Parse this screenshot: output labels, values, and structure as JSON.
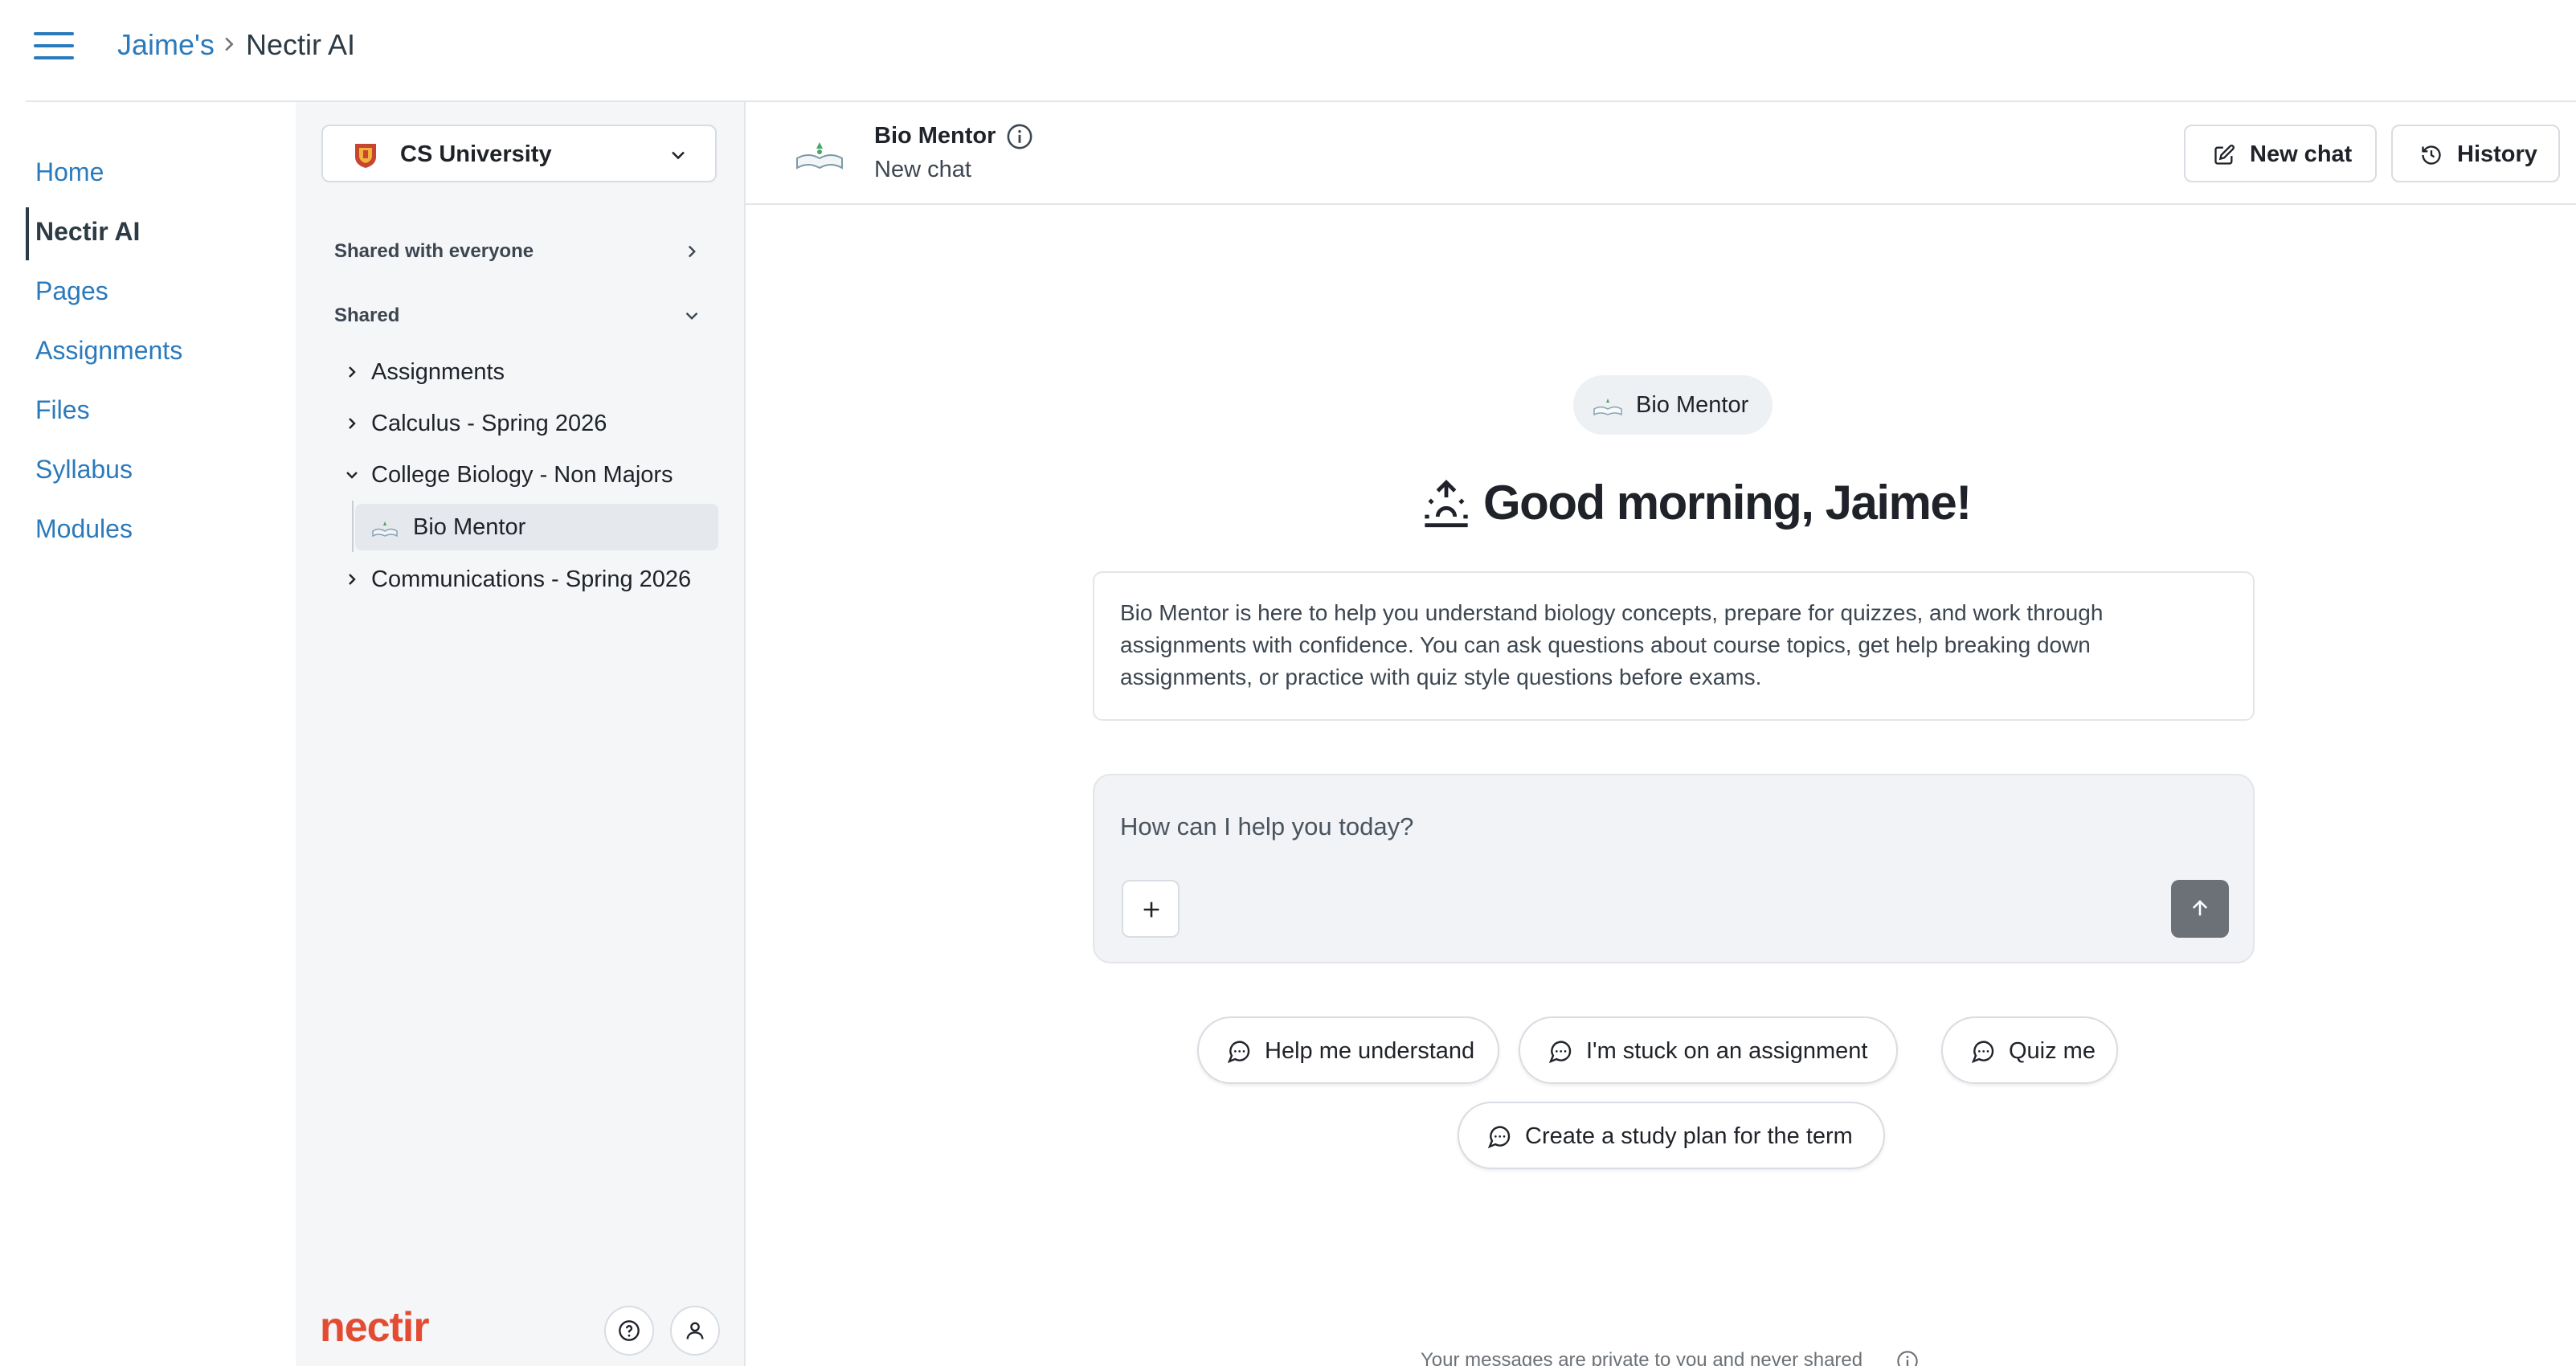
{
  "breadcrumb": {
    "parent": "Jaime's",
    "current": "Nectir AI"
  },
  "course_nav": {
    "items": [
      {
        "label": "Home"
      },
      {
        "label": "Nectir AI",
        "active": true
      },
      {
        "label": "Pages"
      },
      {
        "label": "Assignments"
      },
      {
        "label": "Files"
      },
      {
        "label": "Syllabus"
      },
      {
        "label": "Modules"
      }
    ]
  },
  "sidebar": {
    "org_selector": {
      "value": "CS University"
    },
    "sections": [
      {
        "title": "Shared with everyone",
        "expanded": false
      },
      {
        "title": "Shared",
        "expanded": true
      }
    ],
    "folders": [
      {
        "label": "Assignments",
        "expanded": false
      },
      {
        "label": "Calculus - Spring 2026",
        "expanded": false
      },
      {
        "label": "College Biology - Non Majors",
        "expanded": true
      },
      {
        "label": "Communications - Spring 2026",
        "expanded": false
      }
    ],
    "active_agent": {
      "label": "Bio Mentor"
    },
    "brand": "nectir"
  },
  "header": {
    "agent_name": "Bio Mentor",
    "subtitle": "New chat",
    "new_chat_label": "New chat",
    "history_label": "History"
  },
  "welcome": {
    "agent_pill": "Bio Mentor",
    "greeting": "Good morning, Jaime!",
    "description": "Bio Mentor is here to help you understand biology concepts, prepare for quizzes, and work through assignments with confidence. You can ask questions about course topics, get help breaking down assignments, or practice with quiz style questions before exams."
  },
  "composer": {
    "placeholder": "How can I help you today?",
    "value": ""
  },
  "suggestions": [
    {
      "label": "Help me understand"
    },
    {
      "label": "I'm stuck on an assignment"
    },
    {
      "label": "Quiz me"
    },
    {
      "label": "Create a study plan for the term"
    }
  ],
  "footer": {
    "privacy_note": "Your messages are private to you and never shared"
  },
  "colors": {
    "link": "#2b7abc",
    "brand": "#e34c32",
    "send_button": "#6b7176",
    "sidebar_bg": "#f5f6f8"
  }
}
